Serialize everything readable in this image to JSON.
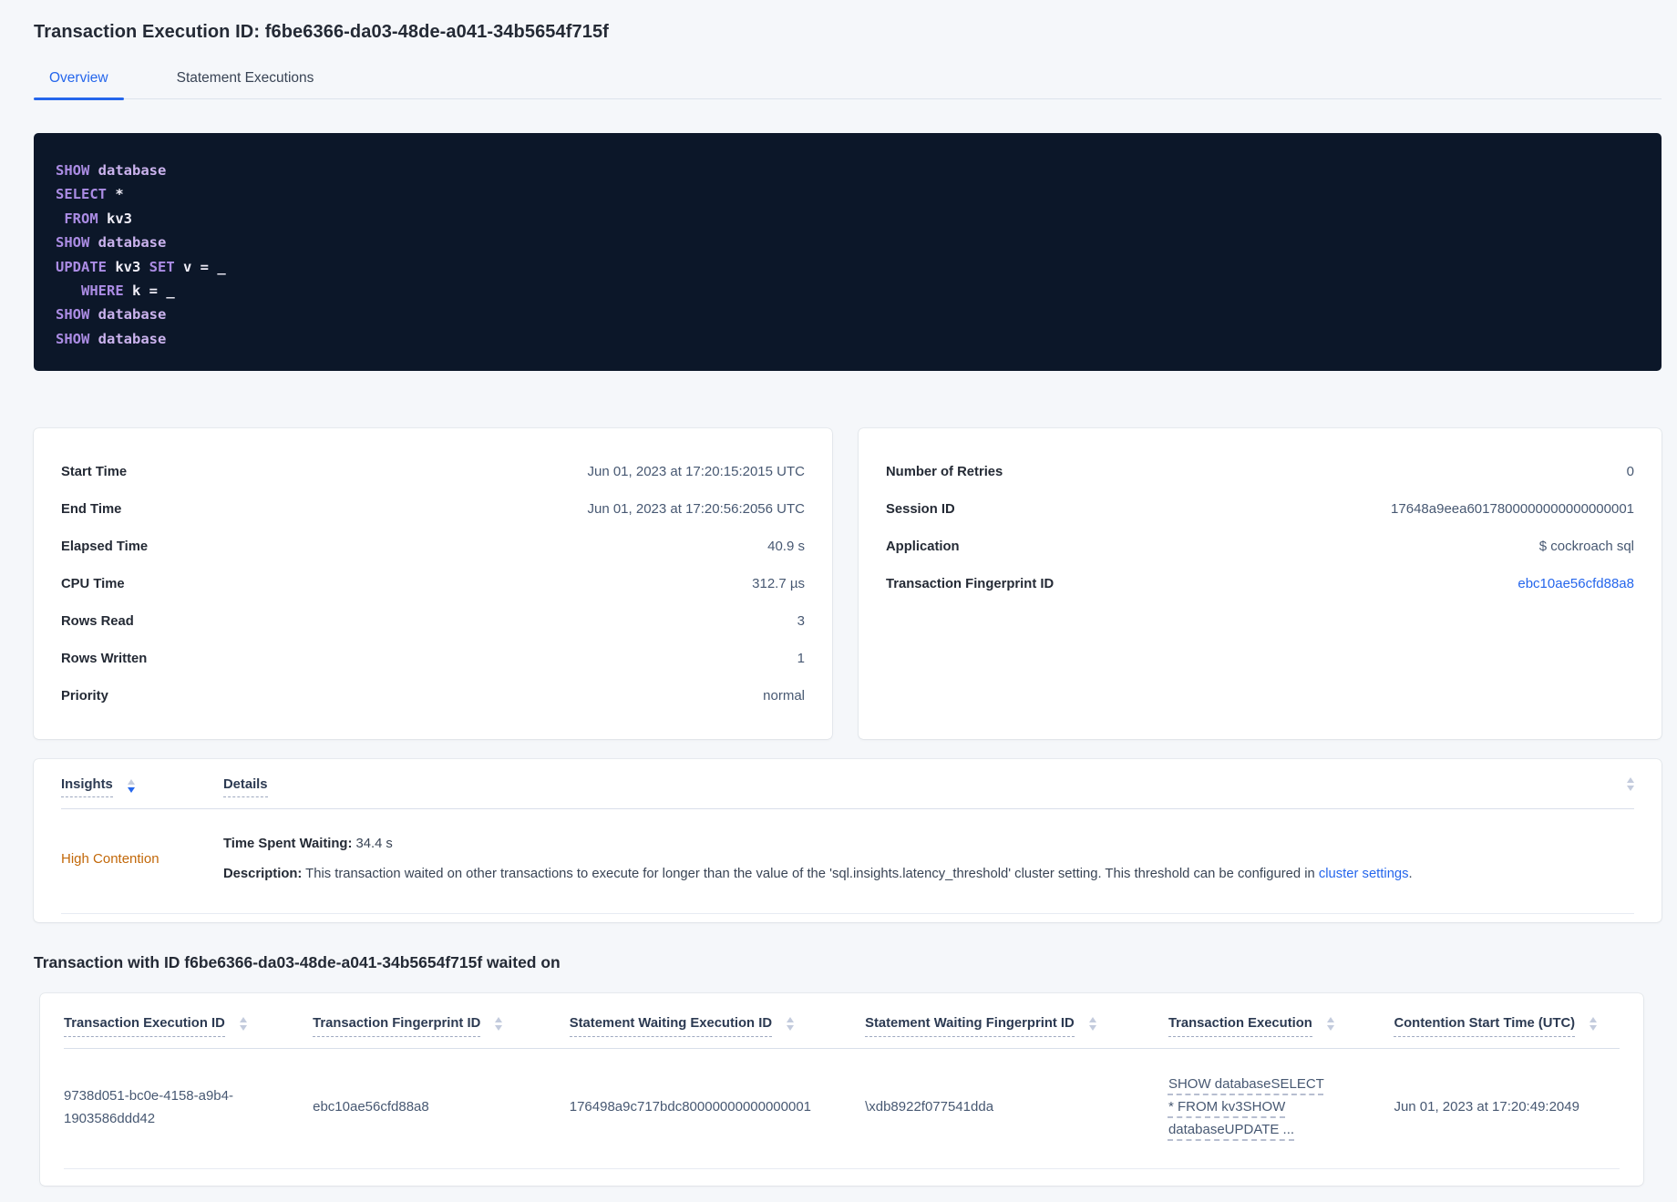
{
  "page": {
    "title": "Transaction Execution ID: f6be6366-da03-48de-a041-34b5654f715f"
  },
  "tabs": [
    {
      "label": "Overview"
    },
    {
      "label": "Statement Executions"
    }
  ],
  "sql": {
    "lines": [
      {
        "spans": [
          {
            "t": "SHOW"
          },
          {
            "t": " database"
          }
        ]
      },
      {
        "spans": [
          {
            "t": "SELECT"
          },
          {
            "t": " *"
          }
        ]
      },
      {
        "spans": [
          {
            "t": " FROM"
          },
          {
            "t": " kv3"
          }
        ]
      },
      {
        "spans": [
          {
            "t": "SHOW"
          },
          {
            "t": " database"
          }
        ]
      },
      {
        "spans": [
          {
            "t": "UPDATE"
          },
          {
            "t": " kv3"
          },
          {
            "t": " SET"
          },
          {
            "t": " v = _"
          }
        ]
      },
      {
        "spans": [
          {
            "t": "   WHERE"
          },
          {
            "t": " k = _"
          }
        ]
      },
      {
        "spans": [
          {
            "t": "SHOW"
          },
          {
            "t": " database"
          }
        ]
      },
      {
        "spans": [
          {
            "t": "SHOW"
          },
          {
            "t": " database"
          }
        ]
      }
    ]
  },
  "summary_left": {
    "rows": [
      {
        "label": "Start Time",
        "value": "Jun 01, 2023 at 17:20:15:2015 UTC"
      },
      {
        "label": "End Time",
        "value": "Jun 01, 2023 at 17:20:56:2056 UTC"
      },
      {
        "label": "Elapsed Time",
        "value": "40.9 s"
      },
      {
        "label": "CPU Time",
        "value": "312.7 µs"
      },
      {
        "label": "Rows Read",
        "value": "3"
      },
      {
        "label": "Rows Written",
        "value": "1"
      },
      {
        "label": "Priority",
        "value": "normal"
      }
    ]
  },
  "summary_right": {
    "rows": [
      {
        "label": "Number of Retries",
        "value": "0"
      },
      {
        "label": "Session ID",
        "value": "17648a9eea6017800000000000000001"
      },
      {
        "label": "Application",
        "value": "$ cockroach sql"
      }
    ],
    "fingerprint_label": "Transaction Fingerprint ID",
    "fingerprint_value": "ebc10ae56cfd88a8"
  },
  "insights": {
    "col_insights": "Insights",
    "col_details": "Details",
    "row": {
      "insight": "High Contention",
      "waiting_label": "Time Spent Waiting:",
      "waiting_value": " 34.4 s",
      "description_label": "Description:",
      "description_text": " This transaction waited on other transactions to execute for longer than the value of the 'sql.insights.latency_threshold' cluster setting. This threshold can be configured in ",
      "description_link": "cluster settings",
      "description_end": "."
    }
  },
  "waited": {
    "heading": "Transaction with ID f6be6366-da03-48de-a041-34b5654f715f waited on",
    "columns": [
      {
        "label": "Transaction Execution ID"
      },
      {
        "label": "Transaction Fingerprint ID"
      },
      {
        "label": "Statement Waiting Execution ID"
      },
      {
        "label": "Statement Waiting Fingerprint ID"
      },
      {
        "label": "Transaction Execution"
      },
      {
        "label": "Contention Start Time (UTC)"
      }
    ],
    "row": {
      "txn_exec_id": "9738d051-bc0e-4158-a9b4-1903586ddd42",
      "txn_fingerprint_id": "ebc10ae56cfd88a8",
      "stmt_waiting_exec_id": "176498a9c717bdc80000000000000001",
      "stmt_waiting_fingerprint_id": "\\xdb8922f077541dda",
      "txn_execution": "SHOW databaseSELECT * FROM kv3SHOW databaseUPDATE ...",
      "contention_start": "Jun 01, 2023 at 17:20:49:2049"
    }
  },
  "colors": {
    "accent_blue": "#2566ec",
    "insight_orange": "#c26809",
    "sql_bg": "#0c1729",
    "sql_keyword": "#ab8ce4",
    "sql_identifier": "#cbb3ee",
    "page_bg": "#f5f7fa"
  }
}
